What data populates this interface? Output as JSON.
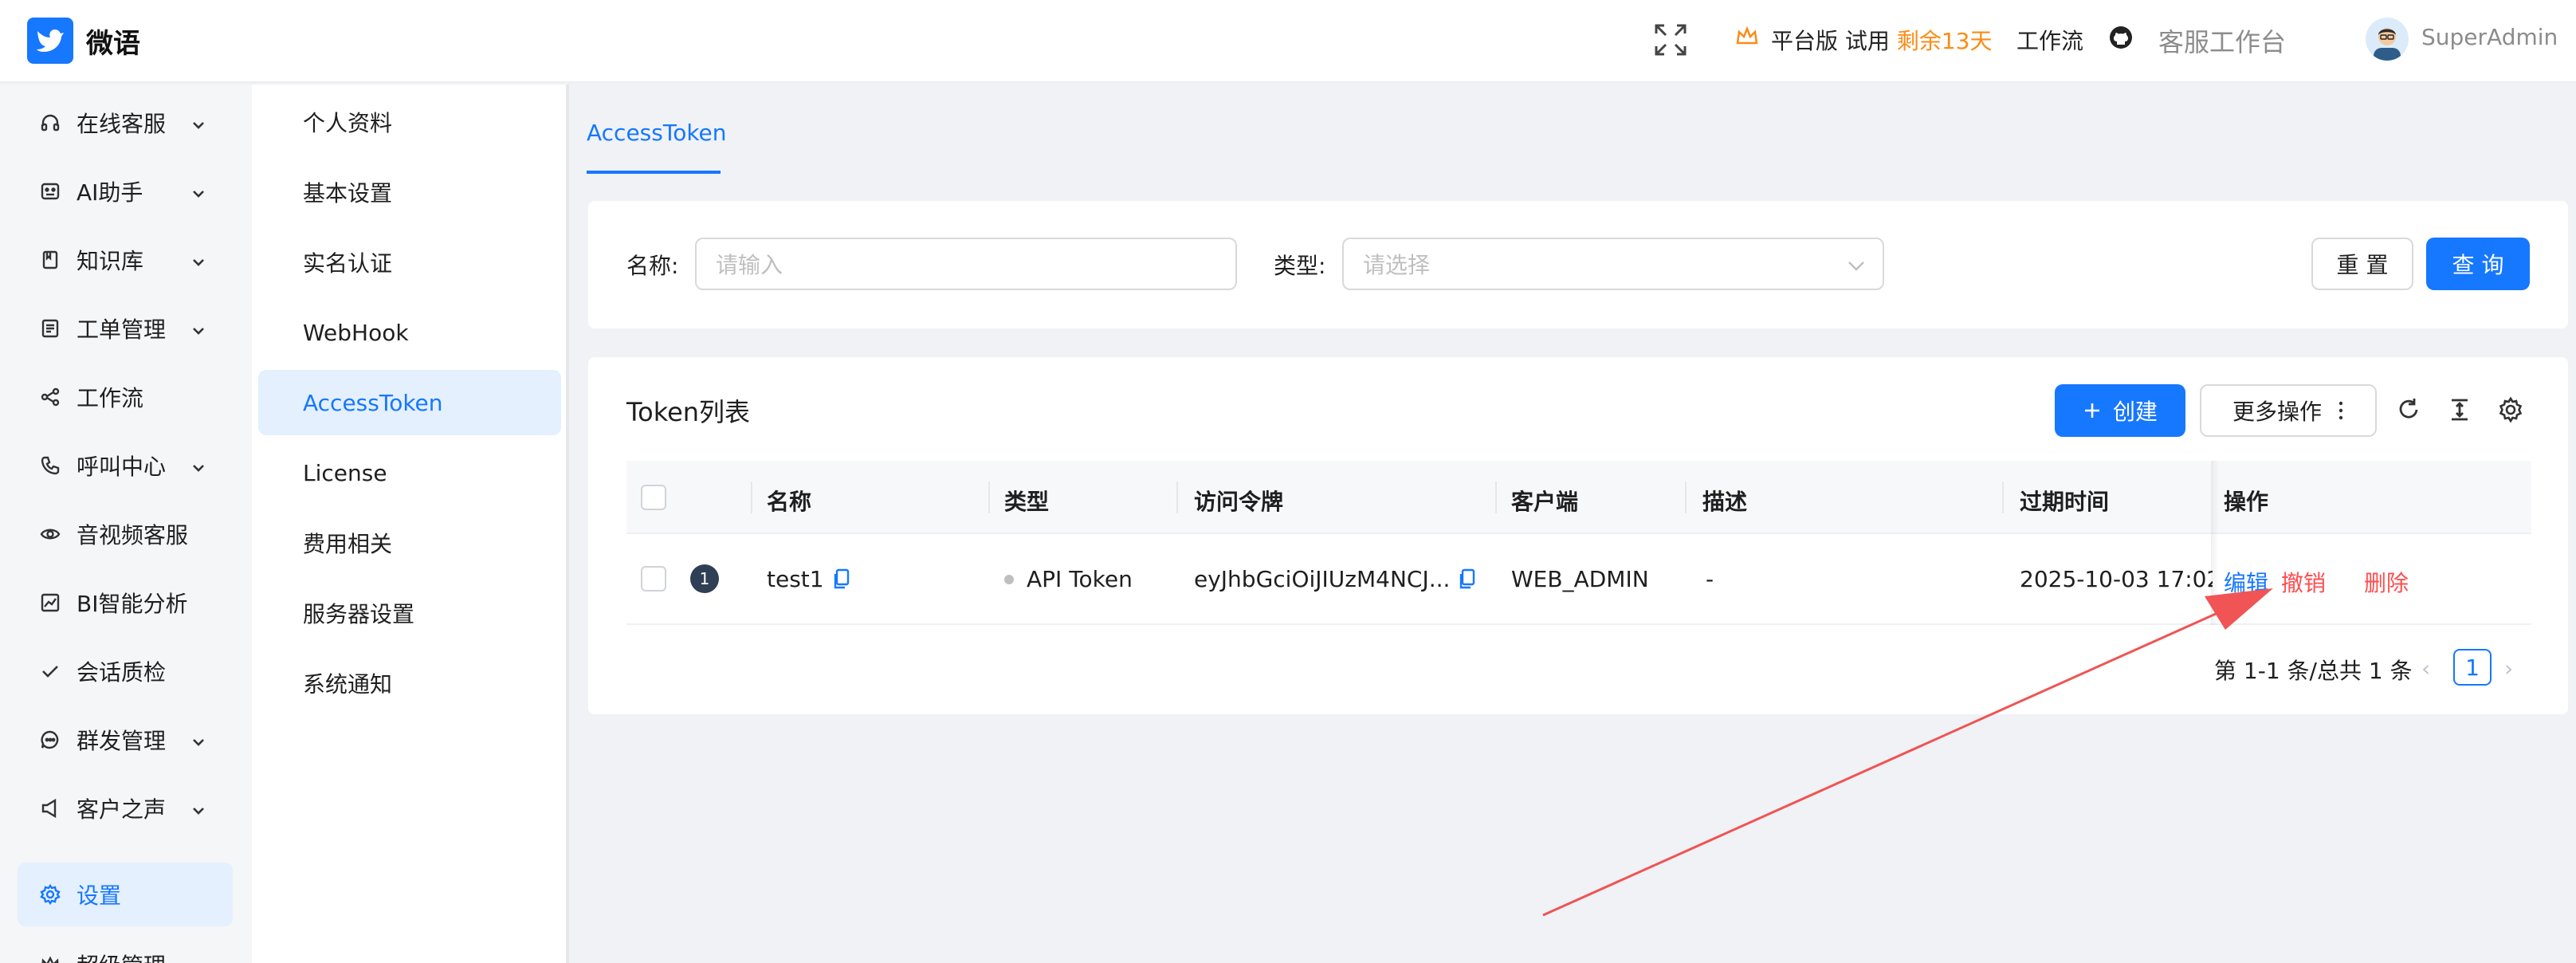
{
  "app": {
    "name": "微语"
  },
  "header": {
    "plan_label": "平台版 试用",
    "plan_remaining": "剩余13天",
    "workflow": "工作流",
    "agent_desk": "客服工作台",
    "username": "SuperAdmin"
  },
  "nav": {
    "items": [
      {
        "label": "在线客服",
        "icon": "headset-icon"
      },
      {
        "label": "AI助手",
        "icon": "robot-icon"
      },
      {
        "label": "知识库",
        "icon": "book-icon"
      },
      {
        "label": "工单管理",
        "icon": "ticket-icon"
      },
      {
        "label": "工作流",
        "icon": "share-icon"
      },
      {
        "label": "呼叫中心",
        "icon": "phone-icon"
      },
      {
        "label": "音视频客服",
        "icon": "eye-icon"
      },
      {
        "label": "BI智能分析",
        "icon": "chart-icon"
      },
      {
        "label": "会话质检",
        "icon": "check-icon"
      },
      {
        "label": "群发管理",
        "icon": "message-icon"
      },
      {
        "label": "客户之声",
        "icon": "sound-icon"
      },
      {
        "label": "设置",
        "icon": "gear-icon"
      },
      {
        "label": "超级管理",
        "icon": "crown-icon"
      }
    ],
    "active": "设置"
  },
  "subnav": {
    "items": [
      "个人资料",
      "基本设置",
      "实名认证",
      "WebHook",
      "AccessToken",
      "License",
      "费用相关",
      "服务器设置",
      "系统通知"
    ],
    "active": "AccessToken"
  },
  "tab": {
    "label": "AccessToken"
  },
  "search": {
    "name_label": "名称:",
    "name_placeholder": "请输入",
    "type_label": "类型:",
    "type_placeholder": "请选择",
    "reset": "重 置",
    "query": "查 询"
  },
  "table": {
    "title": "Token列表",
    "create": "创建",
    "more": "更多操作",
    "columns": [
      "名称",
      "类型",
      "访问令牌",
      "客户端",
      "描述",
      "过期时间",
      "操作"
    ],
    "rows": [
      {
        "index": "1",
        "name": "test1",
        "type": "API Token",
        "token": "eyJhbGciOiJIUzM4NCJ...",
        "client": "WEB_ADMIN",
        "description": "-",
        "expires": "2025-10-03 17:02",
        "actions": {
          "edit": "编辑",
          "revoke": "撤销",
          "delete": "删除"
        }
      }
    ],
    "pager": {
      "summary": "第 1-1 条/总共 1 条",
      "current": "1"
    }
  },
  "colors": {
    "primary": "#1677ff",
    "danger": "#ff4d4f",
    "warning": "#fa8c16",
    "annotation_arrow": "#f05454"
  }
}
